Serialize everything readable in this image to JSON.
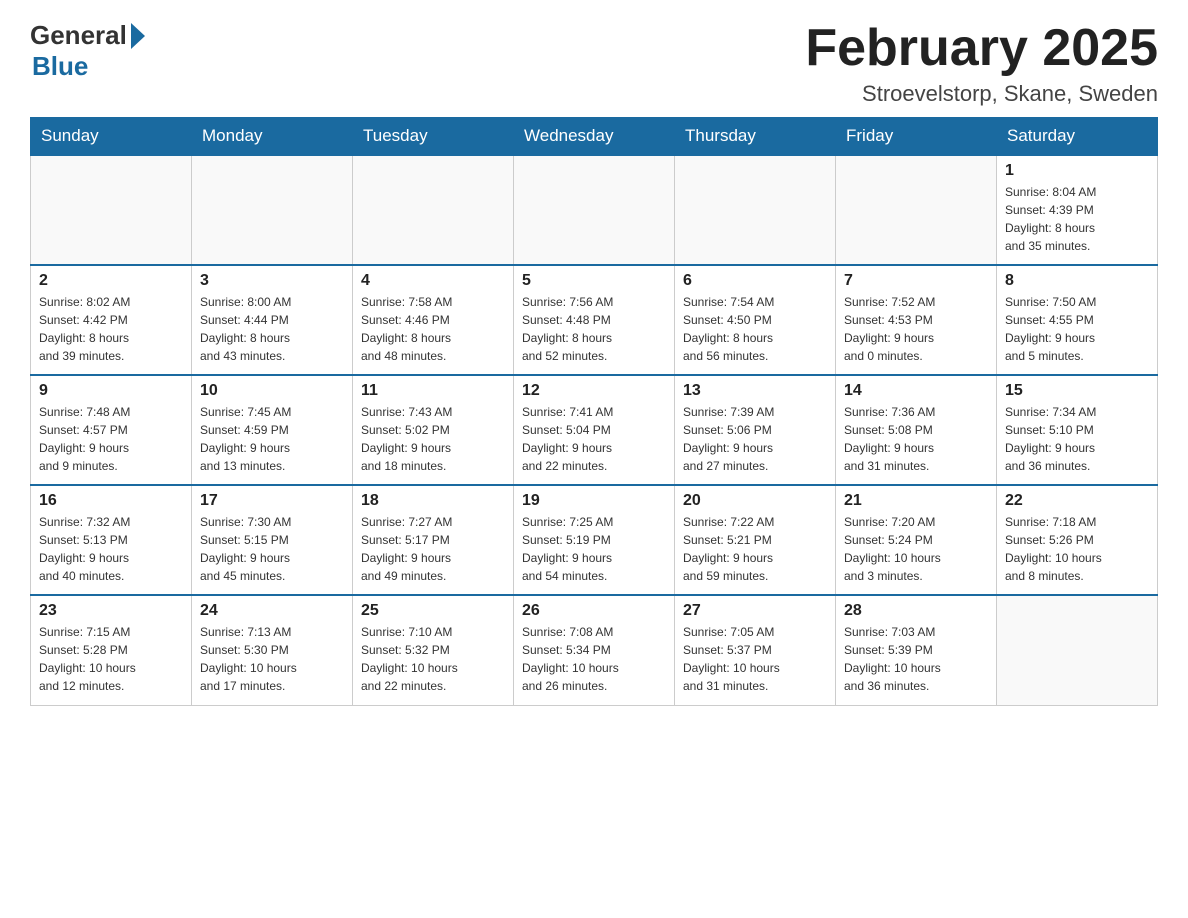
{
  "logo": {
    "general": "General",
    "blue": "Blue"
  },
  "title": "February 2025",
  "location": "Stroevelstorp, Skane, Sweden",
  "days_of_week": [
    "Sunday",
    "Monday",
    "Tuesday",
    "Wednesday",
    "Thursday",
    "Friday",
    "Saturday"
  ],
  "weeks": [
    [
      {
        "day": "",
        "info": ""
      },
      {
        "day": "",
        "info": ""
      },
      {
        "day": "",
        "info": ""
      },
      {
        "day": "",
        "info": ""
      },
      {
        "day": "",
        "info": ""
      },
      {
        "day": "",
        "info": ""
      },
      {
        "day": "1",
        "info": "Sunrise: 8:04 AM\nSunset: 4:39 PM\nDaylight: 8 hours\nand 35 minutes."
      }
    ],
    [
      {
        "day": "2",
        "info": "Sunrise: 8:02 AM\nSunset: 4:42 PM\nDaylight: 8 hours\nand 39 minutes."
      },
      {
        "day": "3",
        "info": "Sunrise: 8:00 AM\nSunset: 4:44 PM\nDaylight: 8 hours\nand 43 minutes."
      },
      {
        "day": "4",
        "info": "Sunrise: 7:58 AM\nSunset: 4:46 PM\nDaylight: 8 hours\nand 48 minutes."
      },
      {
        "day": "5",
        "info": "Sunrise: 7:56 AM\nSunset: 4:48 PM\nDaylight: 8 hours\nand 52 minutes."
      },
      {
        "day": "6",
        "info": "Sunrise: 7:54 AM\nSunset: 4:50 PM\nDaylight: 8 hours\nand 56 minutes."
      },
      {
        "day": "7",
        "info": "Sunrise: 7:52 AM\nSunset: 4:53 PM\nDaylight: 9 hours\nand 0 minutes."
      },
      {
        "day": "8",
        "info": "Sunrise: 7:50 AM\nSunset: 4:55 PM\nDaylight: 9 hours\nand 5 minutes."
      }
    ],
    [
      {
        "day": "9",
        "info": "Sunrise: 7:48 AM\nSunset: 4:57 PM\nDaylight: 9 hours\nand 9 minutes."
      },
      {
        "day": "10",
        "info": "Sunrise: 7:45 AM\nSunset: 4:59 PM\nDaylight: 9 hours\nand 13 minutes."
      },
      {
        "day": "11",
        "info": "Sunrise: 7:43 AM\nSunset: 5:02 PM\nDaylight: 9 hours\nand 18 minutes."
      },
      {
        "day": "12",
        "info": "Sunrise: 7:41 AM\nSunset: 5:04 PM\nDaylight: 9 hours\nand 22 minutes."
      },
      {
        "day": "13",
        "info": "Sunrise: 7:39 AM\nSunset: 5:06 PM\nDaylight: 9 hours\nand 27 minutes."
      },
      {
        "day": "14",
        "info": "Sunrise: 7:36 AM\nSunset: 5:08 PM\nDaylight: 9 hours\nand 31 minutes."
      },
      {
        "day": "15",
        "info": "Sunrise: 7:34 AM\nSunset: 5:10 PM\nDaylight: 9 hours\nand 36 minutes."
      }
    ],
    [
      {
        "day": "16",
        "info": "Sunrise: 7:32 AM\nSunset: 5:13 PM\nDaylight: 9 hours\nand 40 minutes."
      },
      {
        "day": "17",
        "info": "Sunrise: 7:30 AM\nSunset: 5:15 PM\nDaylight: 9 hours\nand 45 minutes."
      },
      {
        "day": "18",
        "info": "Sunrise: 7:27 AM\nSunset: 5:17 PM\nDaylight: 9 hours\nand 49 minutes."
      },
      {
        "day": "19",
        "info": "Sunrise: 7:25 AM\nSunset: 5:19 PM\nDaylight: 9 hours\nand 54 minutes."
      },
      {
        "day": "20",
        "info": "Sunrise: 7:22 AM\nSunset: 5:21 PM\nDaylight: 9 hours\nand 59 minutes."
      },
      {
        "day": "21",
        "info": "Sunrise: 7:20 AM\nSunset: 5:24 PM\nDaylight: 10 hours\nand 3 minutes."
      },
      {
        "day": "22",
        "info": "Sunrise: 7:18 AM\nSunset: 5:26 PM\nDaylight: 10 hours\nand 8 minutes."
      }
    ],
    [
      {
        "day": "23",
        "info": "Sunrise: 7:15 AM\nSunset: 5:28 PM\nDaylight: 10 hours\nand 12 minutes."
      },
      {
        "day": "24",
        "info": "Sunrise: 7:13 AM\nSunset: 5:30 PM\nDaylight: 10 hours\nand 17 minutes."
      },
      {
        "day": "25",
        "info": "Sunrise: 7:10 AM\nSunset: 5:32 PM\nDaylight: 10 hours\nand 22 minutes."
      },
      {
        "day": "26",
        "info": "Sunrise: 7:08 AM\nSunset: 5:34 PM\nDaylight: 10 hours\nand 26 minutes."
      },
      {
        "day": "27",
        "info": "Sunrise: 7:05 AM\nSunset: 5:37 PM\nDaylight: 10 hours\nand 31 minutes."
      },
      {
        "day": "28",
        "info": "Sunrise: 7:03 AM\nSunset: 5:39 PM\nDaylight: 10 hours\nand 36 minutes."
      },
      {
        "day": "",
        "info": ""
      }
    ]
  ]
}
